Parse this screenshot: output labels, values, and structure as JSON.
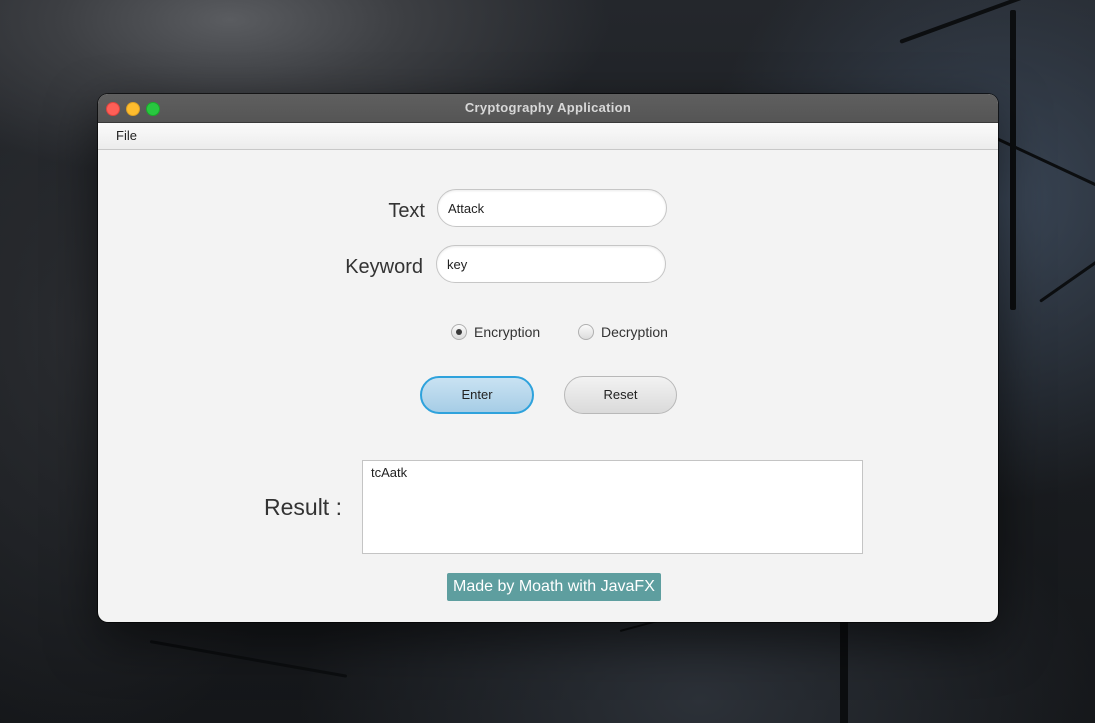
{
  "window": {
    "title": "Cryptography Application"
  },
  "menu": {
    "items": [
      "File"
    ]
  },
  "form": {
    "text_label": "Text",
    "text_value": "Attack",
    "keyword_label": "Keyword",
    "keyword_value": "key"
  },
  "mode": {
    "options": [
      {
        "label": "Encryption",
        "checked": true
      },
      {
        "label": "Decryption",
        "checked": false
      }
    ]
  },
  "actions": {
    "enter_label": "Enter",
    "reset_label": "Reset"
  },
  "result": {
    "label": "Result :",
    "value": "tcAatk"
  },
  "footer": {
    "credit": "Made by Moath with JavaFX"
  },
  "colors": {
    "accent_focus": "#2ea2dc",
    "credit_bg": "#5e9e9f"
  }
}
